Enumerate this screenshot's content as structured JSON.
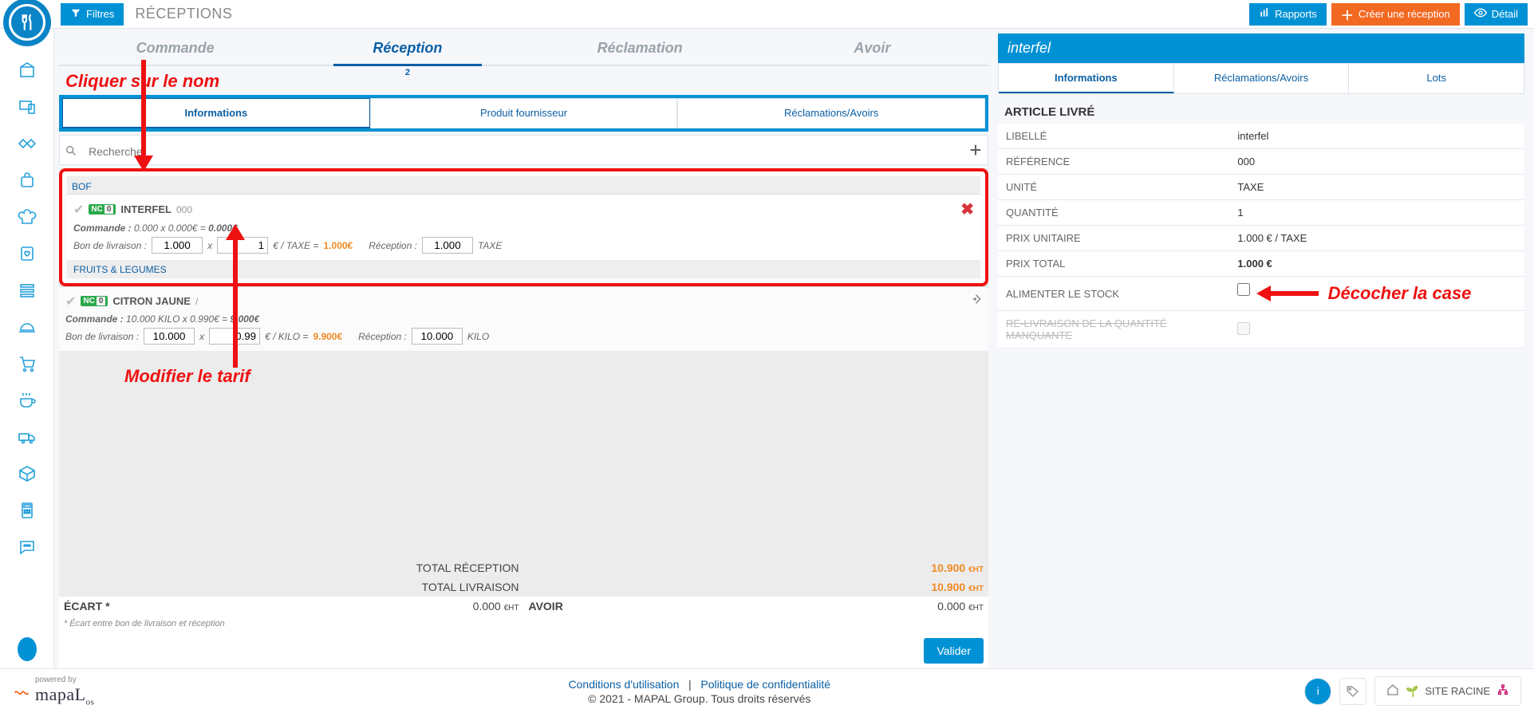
{
  "topbar": {
    "filters_label": "Filtres",
    "page_title": "RÉCEPTIONS",
    "reports_label": "Rapports",
    "create_label": "Créer une réception",
    "detail_label": "Détail"
  },
  "primary_tabs": {
    "commande": "Commande",
    "reception": "Réception",
    "reception_count": "2",
    "reclamation": "Réclamation",
    "avoir": "Avoir"
  },
  "annotations": {
    "click_name": "Cliquer sur le nom",
    "modify_price": "Modifier le tarif",
    "uncheck_box": "Décocher la case"
  },
  "subtabs": {
    "informations": "Informations",
    "produit": "Produit fournisseur",
    "reclam": "Réclamations/Avoirs"
  },
  "search": {
    "placeholder": "Rechercher"
  },
  "categories": {
    "bof": "BOF",
    "fruits": "FRUITS & LEGUMES"
  },
  "items": [
    {
      "name": "INTERFEL",
      "ref": "000",
      "commande_text": "0.000  x  0.000€ =  ",
      "commande_total": "0.000€",
      "bon_label": "Bon de livraison :",
      "bon_qty": "1.000",
      "bon_price": "1",
      "unit_text": "€ / TAXE =",
      "bon_total": "1.000€",
      "recep_label": "Réception :",
      "recep_qty": "1.000",
      "recep_unit": "TAXE"
    },
    {
      "name": "CITRON JAUNE",
      "ref": "/",
      "commande_text": "10.000 KILO x  0.990€ =  ",
      "commande_total": "9.000€",
      "bon_label": "Bon de livraison :",
      "bon_qty": "10.000",
      "bon_price": "0.99",
      "unit_text": "€ / KILO =",
      "bon_total": "9.900€",
      "recep_label": "Réception :",
      "recep_qty": "10.000",
      "recep_unit": "KILO"
    }
  ],
  "totals": {
    "reception_label": "TOTAL RÉCEPTION",
    "reception_value": "10.900",
    "livraison_label": "TOTAL LIVRAISON",
    "livraison_value": "10.900",
    "ht": "€HT",
    "ecart_label": "ÉCART *",
    "ecart_value": "0.000",
    "avoir_label": "AVOIR",
    "avoir_value": "0.000",
    "note": "* Écart entre bon de livraison et réception",
    "validate": "Valider"
  },
  "right": {
    "title": "interfel",
    "tabs": {
      "info": "Informations",
      "reclam": "Réclamations/Avoirs",
      "lots": "Lots"
    },
    "section_title": "ARTICLE LIVRÉ",
    "fields": {
      "libelle_label": "LIBELLÉ",
      "libelle_value": "interfel",
      "reference_label": "RÉFÉRENCE",
      "reference_value": "000",
      "unite_label": "UNITÉ",
      "unite_value": "TAXE",
      "quantite_label": "QUANTITÉ",
      "quantite_value": "1",
      "pu_label": "PRIX UNITAIRE",
      "pu_value": "1.000 € / TAXE",
      "pt_label": "PRIX TOTAL",
      "pt_value": "1.000 €",
      "stock_label": "ALIMENTER LE STOCK",
      "reliv_label": "RE-LIVRAISON DE LA QUANTITÉ MANQUANTE"
    }
  },
  "footer": {
    "powered": "powered by",
    "brand": "mapaL",
    "brand_suffix": "os",
    "terms": "Conditions d'utilisation",
    "privacy": "Politique de confidentialité",
    "copyright": "© 2021 - MAPAL Group. Tous droits réservés",
    "site": "SITE RACINE"
  }
}
